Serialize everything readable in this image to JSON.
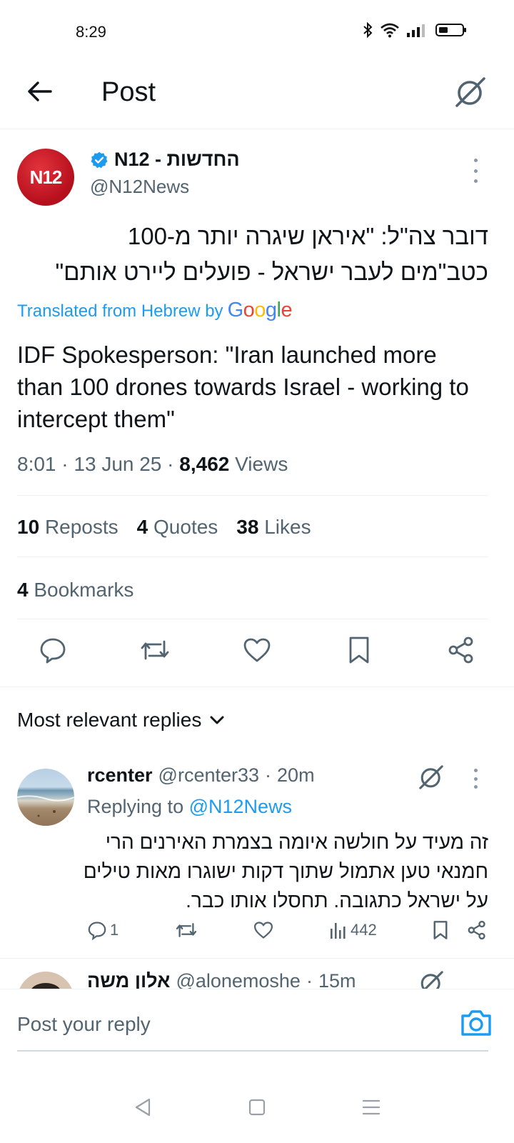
{
  "status_bar": {
    "time": "8:29"
  },
  "header": {
    "title": "Post"
  },
  "post": {
    "author_name": "N12 - החדשות",
    "avatar_text": "N12",
    "handle": "@N12News",
    "text_hebrew_line1": "דובר צה\"ל: \"איראן שיגרה יותר מ-100",
    "text_hebrew_line2": "כטב\"מים לעבר ישראל - פועלים ליירט אותם\"",
    "translated_label": "Translated from Hebrew by",
    "translated_brand": "Google",
    "text_en": "IDF Spokesperson: \"Iran launched more than 100 drones towards Israel - working to intercept them\"",
    "time": "8:01",
    "date": "13 Jun 25",
    "views_count": "8,462",
    "views_label": "Views",
    "separator": "·",
    "reposts_count": "10",
    "reposts_label": "Reposts",
    "quotes_count": "4",
    "quotes_label": "Quotes",
    "likes_count": "38",
    "likes_label": "Likes",
    "bookmarks_count": "4",
    "bookmarks_label": "Bookmarks"
  },
  "replies_sort": {
    "label": "Most relevant replies"
  },
  "reply1": {
    "name": "rcenter",
    "handle": "@rcenter33",
    "dot": "·",
    "age": "20m",
    "replying_label": "Replying to",
    "replying_handle": "@N12News",
    "text": "זה מעיד על חולשה איומה בצמרת האירנים הרי חמנאי טען אתמול שתוך דקות ישוגרו מאות טילים על ישראל כתגובה. תחסלו אותו כבר.",
    "reply_count": "1",
    "views": "442"
  },
  "reply2": {
    "name": "אלון משה",
    "handle": "@alonemoshe",
    "dot": "·",
    "age": "15m"
  },
  "compose": {
    "placeholder": "Post your reply"
  },
  "colors": {
    "accent": "#1d9bf0",
    "muted": "#536471",
    "verified": "#1d9bf0",
    "brand_red": "#c8111e"
  }
}
